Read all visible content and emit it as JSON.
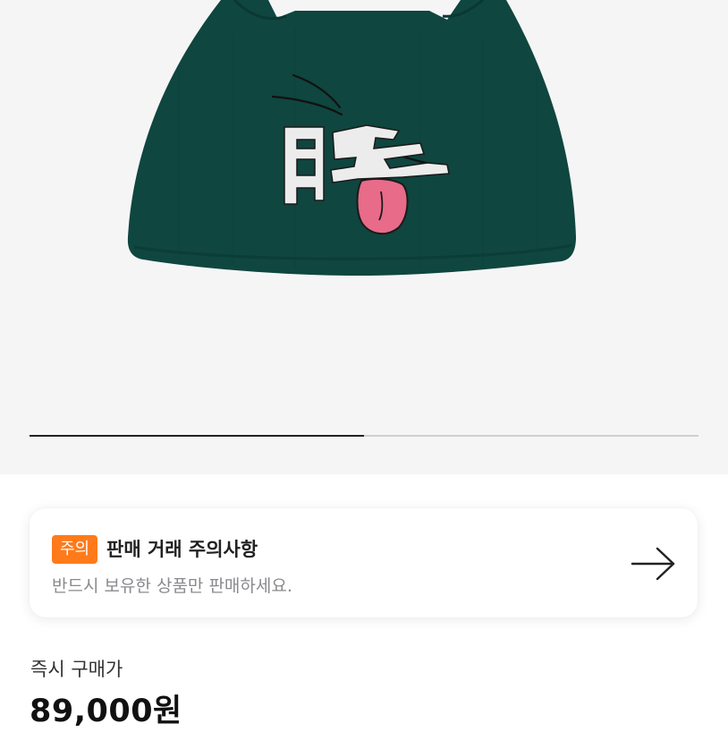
{
  "product": {
    "image_alt": "beanie",
    "image_progress": 0.5
  },
  "notice": {
    "badge": "주의",
    "title": "판매 거래 주의사항",
    "subtitle": "반드시 보유한 상품만 판매하세요.",
    "arrow_icon": "arrow-right-icon",
    "badge_color": "#ff7a1a"
  },
  "price": {
    "label": "즉시 구매가",
    "value": "89,000원"
  },
  "colors": {
    "beanie": "#0f463f",
    "tongue": "#e86b8a"
  }
}
